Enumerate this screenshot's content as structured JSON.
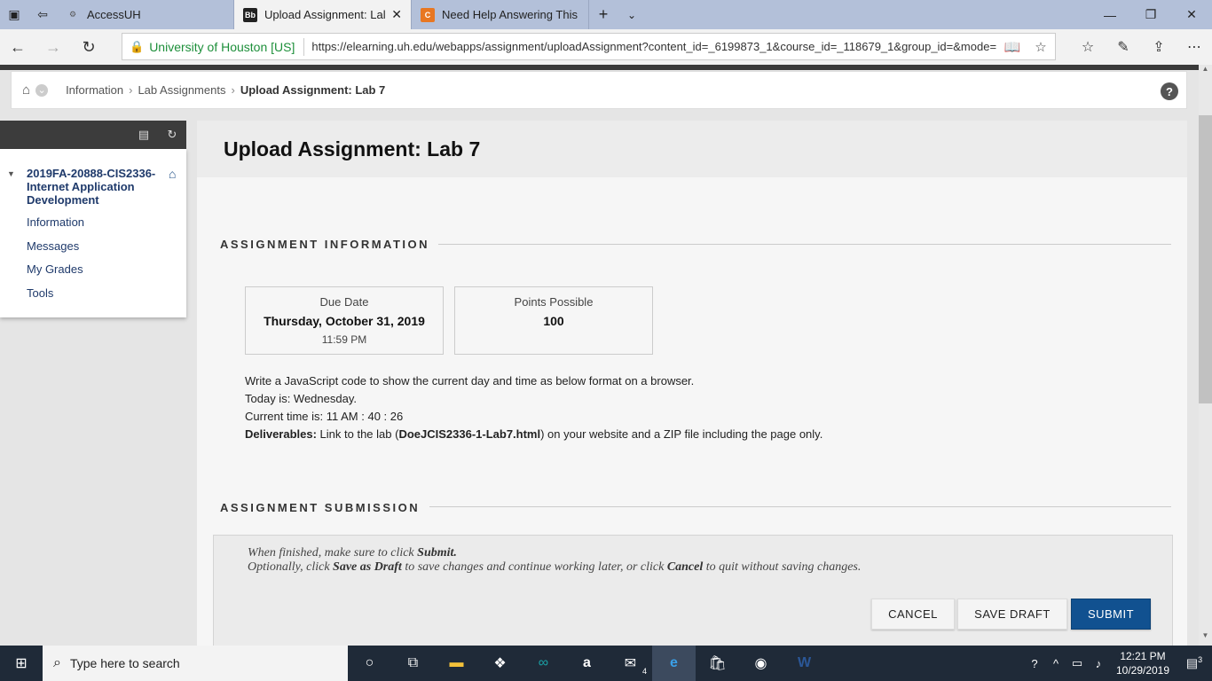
{
  "browser": {
    "tabs": [
      {
        "title": "AccessUH",
        "icon": "accessuh-icon",
        "active": false
      },
      {
        "title": "Upload Assignment: Lal",
        "icon": "blackboard-icon",
        "active": true
      },
      {
        "title": "Need Help Answering This |",
        "icon": "chegg-icon",
        "active": false
      }
    ],
    "url_site": "University of Houston [US]",
    "url": "https://elearning.uh.edu/webapps/assignment/uploadAssignment?content_id=_6199873_1&course_id=_118679_1&group_id=&mode="
  },
  "breadcrumb": {
    "items": [
      "Information",
      "Lab Assignments"
    ],
    "current": "Upload Assignment: Lab 7"
  },
  "course_menu": {
    "course_title": "2019FA-20888-CIS2336-Internet Application Development",
    "items": [
      "Information",
      "Messages",
      "My Grades",
      "Tools"
    ]
  },
  "page": {
    "title": "Upload Assignment: Lab 7",
    "section_info": "ASSIGNMENT INFORMATION",
    "due_label": "Due Date",
    "due_date": "Thursday, October 31, 2019",
    "due_time": "11:59 PM",
    "points_label": "Points Possible",
    "points_value": "100",
    "instructions": {
      "line1": "Write a JavaScript code to show the current day and time as below format on a browser.",
      "line2": "Today is: Wednesday.",
      "line3": "Current time is: 11 AM : 40 : 26",
      "deliverables_label": "Deliverables:",
      "deliverables_pre": " Link to the lab (",
      "deliverables_file": "DoeJCIS2336-1-Lab7.html",
      "deliverables_post": ") on your website and a ZIP file including the page only."
    },
    "section_submission": "ASSIGNMENT SUBMISSION",
    "note": {
      "l1_pre": "When finished, make sure to click ",
      "l1_bold": "Submit.",
      "l2_a": "Optionally, click ",
      "l2_b": "Save as Draft",
      "l2_c": " to save changes and continue working later, or click ",
      "l2_d": "Cancel",
      "l2_e": " to quit without saving changes."
    },
    "buttons": {
      "cancel": "CANCEL",
      "save_draft": "SAVE DRAFT",
      "submit": "SUBMIT"
    }
  },
  "taskbar": {
    "search_placeholder": "Type here to search",
    "time": "12:21 PM",
    "date": "10/29/2019",
    "mail_badge": "4",
    "notif_badge": "3"
  },
  "colors": {
    "accent": "#115190",
    "link": "#1f3a6b",
    "secure": "#1d8f3a"
  }
}
